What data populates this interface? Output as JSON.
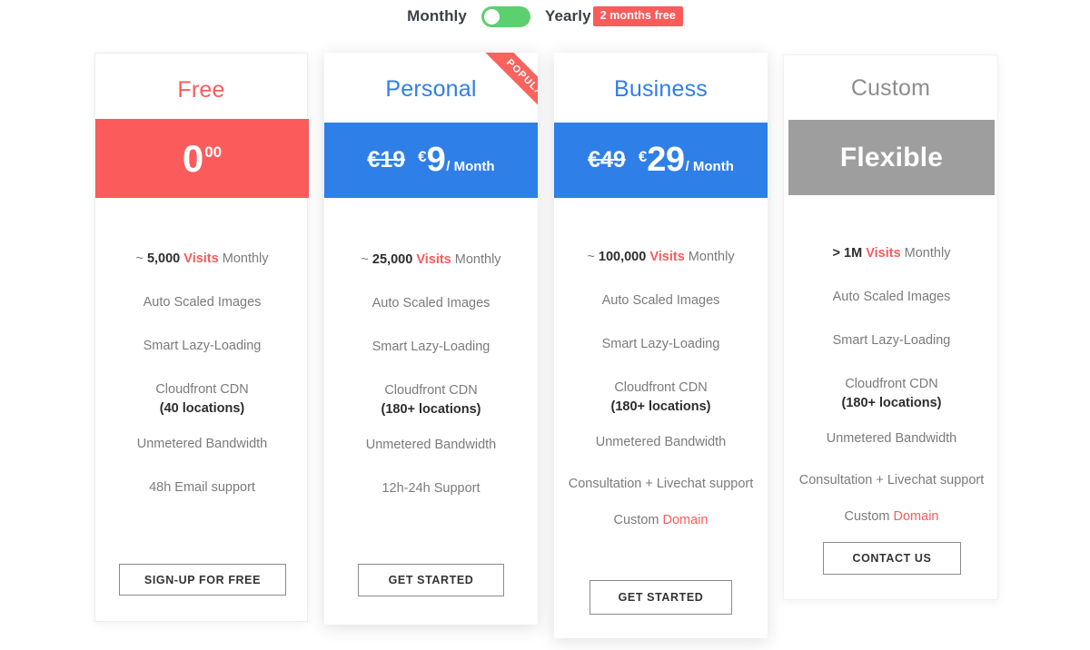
{
  "billing_toggle": {
    "left_label": "Monthly",
    "right_label": "Yearly",
    "promo_badge": "2 months free",
    "selected": "Monthly",
    "track_color": "#5ccf6e",
    "badge_color": "#fb5b5b"
  },
  "colors": {
    "free_accent": "#fb5b5b",
    "paid_accent": "#2e7fe8",
    "custom_accent": "#9e9e9e",
    "ribbon": "#f8635e"
  },
  "plans": [
    {
      "name": "Free",
      "title_color": "#fb5b5b",
      "banner_color": "#fb5b5b",
      "price_kind": "zero",
      "price_whole": "0",
      "price_cents": "00",
      "price_old": "",
      "price_new": "",
      "currency": "€",
      "period": "",
      "ribbon": "",
      "features": [
        {
          "prefix": "~ ",
          "bold": "5,000 ",
          "highlight": "Visits",
          "suffix": " Monthly",
          "sub": ""
        },
        {
          "prefix": "",
          "bold": "",
          "highlight": "",
          "suffix": "Auto Scaled Images",
          "sub": ""
        },
        {
          "prefix": "",
          "bold": "",
          "highlight": "",
          "suffix": "Smart Lazy-Loading",
          "sub": ""
        },
        {
          "prefix": "",
          "bold": "",
          "highlight": "",
          "suffix": "Cloudfront CDN",
          "sub": "(40 locations)"
        },
        {
          "prefix": "",
          "bold": "",
          "highlight": "",
          "suffix": "Unmetered Bandwidth",
          "sub": ""
        },
        {
          "prefix": "",
          "bold": "",
          "highlight": "",
          "suffix": "48h Email support",
          "sub": ""
        }
      ],
      "cta": "SIGN-UP FOR FREE"
    },
    {
      "name": "Personal",
      "title_color": "#2e7fe8",
      "banner_color": "#2e7fe8",
      "price_kind": "discount",
      "price_whole": "",
      "price_cents": "",
      "price_old": "€19",
      "price_new": "9",
      "currency": "€",
      "period": "/ Month",
      "ribbon": "POPULAR",
      "features": [
        {
          "prefix": "~ ",
          "bold": "25,000 ",
          "highlight": "Visits",
          "suffix": " Monthly",
          "sub": ""
        },
        {
          "prefix": "",
          "bold": "",
          "highlight": "",
          "suffix": "Auto Scaled Images",
          "sub": ""
        },
        {
          "prefix": "",
          "bold": "",
          "highlight": "",
          "suffix": "Smart Lazy-Loading",
          "sub": ""
        },
        {
          "prefix": "",
          "bold": "",
          "highlight": "",
          "suffix": "Cloudfront CDN",
          "sub": "(180+ locations)"
        },
        {
          "prefix": "",
          "bold": "",
          "highlight": "",
          "suffix": "Unmetered Bandwidth",
          "sub": ""
        },
        {
          "prefix": "",
          "bold": "",
          "highlight": "",
          "suffix": "12h-24h Support",
          "sub": ""
        }
      ],
      "cta": "GET STARTED"
    },
    {
      "name": "Business",
      "title_color": "#2e7fe8",
      "banner_color": "#2e7fe8",
      "price_kind": "discount",
      "price_whole": "",
      "price_cents": "",
      "price_old": "€49",
      "price_new": "29",
      "currency": "€",
      "period": "/ Month",
      "ribbon": "",
      "features": [
        {
          "prefix": "~ ",
          "bold": "100,000 ",
          "highlight": "Visits",
          "suffix": " Monthly",
          "sub": ""
        },
        {
          "prefix": "",
          "bold": "",
          "highlight": "",
          "suffix": "Auto Scaled Images",
          "sub": ""
        },
        {
          "prefix": "",
          "bold": "",
          "highlight": "",
          "suffix": "Smart Lazy-Loading",
          "sub": ""
        },
        {
          "prefix": "",
          "bold": "",
          "highlight": "",
          "suffix": "Cloudfront CDN",
          "sub": "(180+ locations)"
        },
        {
          "prefix": "",
          "bold": "",
          "highlight": "",
          "suffix": "Unmetered Bandwidth",
          "sub": ""
        },
        {
          "prefix": "",
          "bold": "",
          "highlight": "",
          "suffix": "Consultation + Livechat support",
          "sub": ""
        },
        {
          "prefix": "",
          "bold": "",
          "highlight": "",
          "suffix": "Custom ",
          "trailing_highlight": "Domain",
          "sub": ""
        }
      ],
      "cta": "GET STARTED"
    },
    {
      "name": "Custom",
      "title_color": "#8d8d8d",
      "banner_color": "#9e9e9e",
      "price_kind": "text",
      "price_text": "Flexible",
      "price_whole": "",
      "price_cents": "",
      "price_old": "",
      "price_new": "",
      "currency": "",
      "period": "",
      "ribbon": "",
      "features": [
        {
          "prefix": "> ",
          "bold": "1M ",
          "highlight": "Visits",
          "suffix": " Monthly",
          "sub": ""
        },
        {
          "prefix": "",
          "bold": "",
          "highlight": "",
          "suffix": "Auto Scaled Images",
          "sub": ""
        },
        {
          "prefix": "",
          "bold": "",
          "highlight": "",
          "suffix": "Smart Lazy-Loading",
          "sub": ""
        },
        {
          "prefix": "",
          "bold": "",
          "highlight": "",
          "suffix": "Cloudfront CDN",
          "sub": "(180+ locations)"
        },
        {
          "prefix": "",
          "bold": "",
          "highlight": "",
          "suffix": "Unmetered Bandwidth",
          "sub": ""
        },
        {
          "prefix": "",
          "bold": "",
          "highlight": "",
          "suffix": "Consultation + Livechat support",
          "sub": ""
        },
        {
          "prefix": "",
          "bold": "",
          "highlight": "",
          "suffix": "Custom ",
          "trailing_highlight": "Domain",
          "sub": ""
        }
      ],
      "cta": "CONTACT US"
    }
  ]
}
